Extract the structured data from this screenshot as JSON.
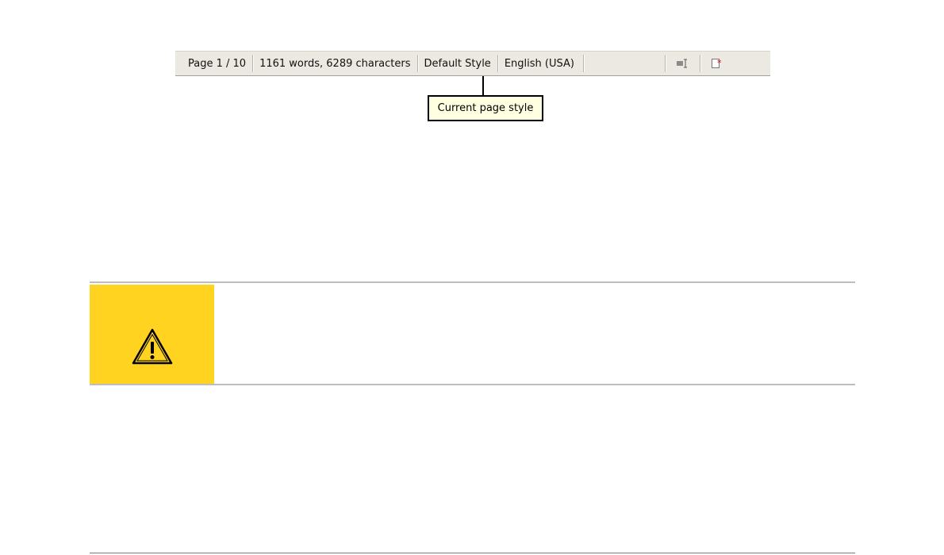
{
  "statusbar": {
    "page": "Page 1 / 10",
    "word_count": "1161 words, 6289 characters",
    "page_style": "Default Style",
    "language": "English (USA)",
    "icons": [
      "selection-mode-icon",
      "document-modified-icon"
    ]
  },
  "tooltip": {
    "text": "Current page style"
  },
  "caution": {
    "icon": "warning-icon",
    "color": "#ffd320"
  }
}
